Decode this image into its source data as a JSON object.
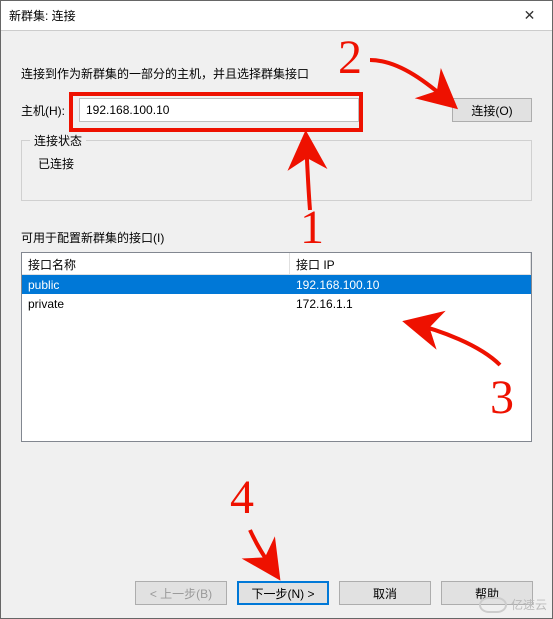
{
  "window": {
    "title": "新群集: 连接"
  },
  "instruction": "连接到作为新群集的一部分的主机，并且选择群集接口",
  "host": {
    "label": "主机(H):",
    "value": "192.168.100.10",
    "connect_label": "连接(O)"
  },
  "status_group": {
    "legend": "连接状态",
    "text": "已连接"
  },
  "interfaces": {
    "label": "可用于配置新群集的接口(I)",
    "columns": {
      "name": "接口名称",
      "ip": "接口 IP"
    },
    "rows": [
      {
        "name": "public",
        "ip": "192.168.100.10",
        "selected": true
      },
      {
        "name": "private",
        "ip": "172.16.1.1",
        "selected": false
      }
    ]
  },
  "buttons": {
    "back": "< 上一步(B)",
    "next": "下一步(N) >",
    "cancel": "取消",
    "help": "帮助"
  },
  "annotations": {
    "n1": "1",
    "n2": "2",
    "n3": "3",
    "n4": "4"
  },
  "watermark": "亿速云"
}
